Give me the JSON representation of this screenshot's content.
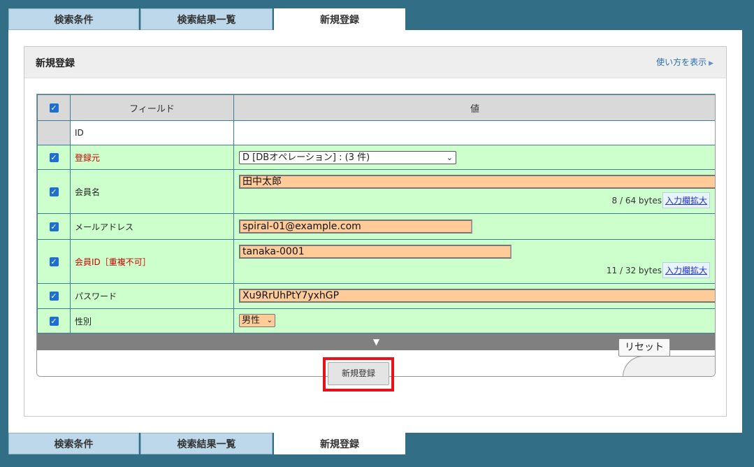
{
  "tabs": [
    {
      "label": "検索条件"
    },
    {
      "label": "検索結果一覧"
    },
    {
      "label": "新規登録",
      "active": true
    }
  ],
  "header": {
    "title": "新規登録",
    "help_link": "使い方を表示"
  },
  "table": {
    "col_field": "フィールド",
    "col_value": "値",
    "rows": [
      {
        "field": "ID"
      },
      {
        "field": "登録元",
        "value": "D [DBオペレーション] : (3 件)"
      },
      {
        "field": "会員名",
        "value": "田中太郎",
        "counter": "8 / 64 bytes",
        "expand": "入力欄拡大"
      },
      {
        "field": "メールアドレス",
        "value": "spiral-01@example.com"
      },
      {
        "field": "会員ID［重複不可］",
        "value": "tanaka-0001",
        "counter": "11 / 32 bytes",
        "expand": "入力欄拡大"
      },
      {
        "field": "パスワード",
        "value": "Xu9RrUhPtY7yxhGP"
      },
      {
        "field": "性別",
        "value": "男性"
      }
    ]
  },
  "scroll_arrow": "▼",
  "buttons": {
    "reset": "リセット",
    "submit": "新規登録"
  },
  "colors": {
    "background": "#326e86",
    "row_green": "#ccffcc",
    "input_orange": "#ffcc99",
    "highlight_red": "#e6131d"
  }
}
